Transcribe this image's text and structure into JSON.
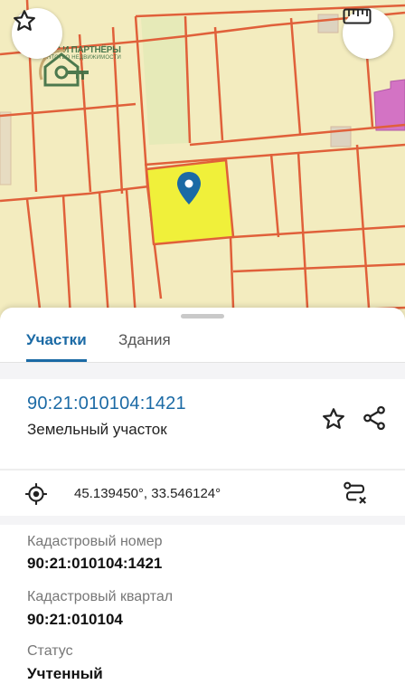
{
  "map": {
    "watermark": {
      "title": "ФУКС И ПАРТНЁРЫ",
      "subtitle": "АГЕНТСТВО НЕДВИЖИМОСТИ"
    },
    "colors": {
      "background": "#f3ecbf",
      "boundary": "#e0603a",
      "selected_parcel": "#f0f03a",
      "marker": "#1b6aa5",
      "building": "#d373c4"
    }
  },
  "tabs": [
    {
      "label": "Участки",
      "active": true
    },
    {
      "label": "Здания",
      "active": false
    }
  ],
  "parcel": {
    "number": "90:21:010104:1421",
    "type": "Земельный участок",
    "coordinates": "45.139450°, 33.546124°"
  },
  "fields": [
    {
      "label": "Кадастровый номер",
      "value": "90:21:010104:1421"
    },
    {
      "label": "Кадастровый квартал",
      "value": "90:21:010104"
    },
    {
      "label": "Статус",
      "value": "Учтенный"
    }
  ],
  "icons": {
    "map_favorite": "star-outline-icon",
    "map_ruler": "ruler-icon",
    "marker": "map-pin-icon",
    "parcel_favorite": "star-outline-icon",
    "parcel_share": "share-icon",
    "coords": "target-icon",
    "route": "route-icon"
  },
  "accent_color": "#1b6aa5"
}
